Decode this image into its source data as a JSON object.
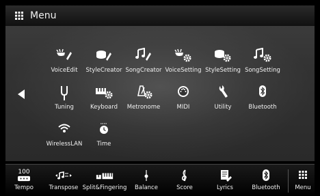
{
  "title_bar": {
    "title": "Menu",
    "icon": "grid-icon"
  },
  "menu_items": [
    {
      "label": "VoiceEdit",
      "icon": "voice-edit-icon"
    },
    {
      "label": "StyleCreator",
      "icon": "style-creator-icon"
    },
    {
      "label": "SongCreator",
      "icon": "song-creator-icon"
    },
    {
      "label": "VoiceSetting",
      "icon": "voice-setting-icon"
    },
    {
      "label": "StyleSetting",
      "icon": "style-setting-icon"
    },
    {
      "label": "SongSetting",
      "icon": "song-setting-icon"
    },
    {
      "label": "Tuning",
      "icon": "tuning-fork-icon"
    },
    {
      "label": "Keyboard",
      "icon": "keyboard-setting-icon"
    },
    {
      "label": "Metronome",
      "icon": "metronome-icon"
    },
    {
      "label": "MIDI",
      "icon": "midi-icon"
    },
    {
      "label": "Utility",
      "icon": "wrench-icon"
    },
    {
      "label": "Bluetooth",
      "icon": "bluetooth-icon"
    },
    {
      "label": "WirelessLAN",
      "icon": "wifi-icon"
    },
    {
      "label": "Time",
      "icon": "clock-icon"
    }
  ],
  "bottom_bar": {
    "tempo_value": "100",
    "items": [
      {
        "label": "Tempo",
        "icon": "tempo-icon"
      },
      {
        "label": "Transpose",
        "icon": "transpose-icon"
      },
      {
        "label": "Split&Fingering",
        "icon": "split-fingering-icon"
      },
      {
        "label": "Balance",
        "icon": "balance-slider-icon"
      },
      {
        "label": "Score",
        "icon": "treble-clef-icon"
      },
      {
        "label": "Lyrics",
        "icon": "lyrics-icon"
      },
      {
        "label": "Bluetooth",
        "icon": "bluetooth-icon"
      },
      {
        "label": "Menu",
        "icon": "grid-icon"
      }
    ]
  }
}
